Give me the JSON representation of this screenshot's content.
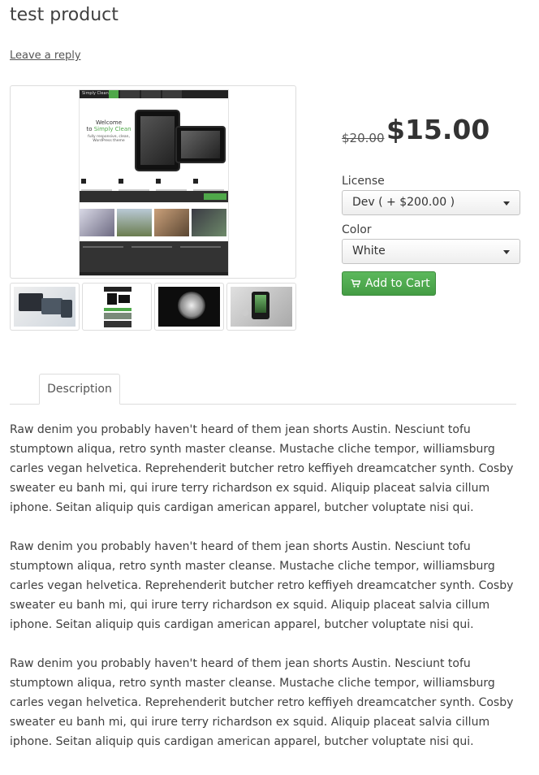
{
  "product": {
    "title": "test product",
    "reply_link": "Leave a reply",
    "old_price": "$20.00",
    "price": "$15.00"
  },
  "gallery": {
    "main_image": "Simply Clean WordPress theme screenshot",
    "thumbnails": [
      "theme-preview-1",
      "theme-preview-2",
      "watch-photo",
      "phone-photo"
    ],
    "preview_logo": "Simply Clean",
    "preview_welcome_1": "Welcome",
    "preview_welcome_2": "to",
    "preview_welcome_brand": "Simply Clean",
    "preview_welcome_sub": "fully responsive, clean, WordPress theme"
  },
  "options": {
    "license": {
      "label": "License",
      "selected": "Dev ( + $200.00 )"
    },
    "color": {
      "label": "Color",
      "selected": "White"
    }
  },
  "cart": {
    "label": "Add to Cart",
    "icon": "cart-icon"
  },
  "tabs": [
    {
      "label": "Description",
      "active": true
    }
  ],
  "description": [
    "Raw denim you probably haven't heard of them jean shorts Austin. Nesciunt tofu stumptown aliqua, retro synth master cleanse. Mustache cliche tempor, williamsburg carles vegan helvetica. Reprehenderit butcher retro keffiyeh dreamcatcher synth. Cosby sweater eu banh mi, qui irure terry richardson ex squid. Aliquip placeat salvia cillum iphone. Seitan aliquip quis cardigan american apparel, butcher voluptate nisi qui.",
    "Raw denim you probably haven't heard of them jean shorts Austin. Nesciunt tofu stumptown aliqua, retro synth master cleanse. Mustache cliche tempor, williamsburg carles vegan helvetica. Reprehenderit butcher retro keffiyeh dreamcatcher synth. Cosby sweater eu banh mi, qui irure terry richardson ex squid. Aliquip placeat salvia cillum iphone. Seitan aliquip quis cardigan american apparel, butcher voluptate nisi qui.",
    "Raw denim you probably haven't heard of them jean shorts Austin. Nesciunt tofu stumptown aliqua, retro synth master cleanse. Mustache cliche tempor, williamsburg carles vegan helvetica. Reprehenderit butcher retro keffiyeh dreamcatcher synth. Cosby sweater eu banh mi, qui irure terry richardson ex squid. Aliquip placeat salvia cillum iphone. Seitan aliquip quis cardigan american apparel, butcher voluptate nisi qui."
  ],
  "colors": {
    "accent_green": "#4fa84a",
    "text": "#404040",
    "border": "#dddddd"
  }
}
